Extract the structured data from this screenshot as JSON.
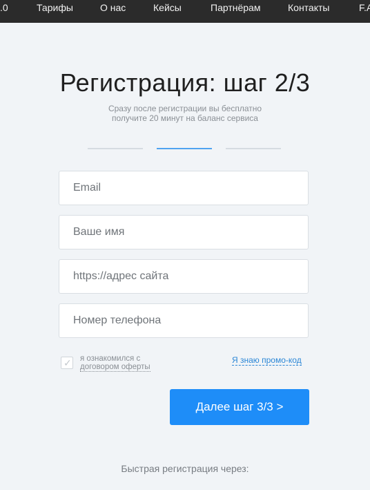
{
  "nav": {
    "items": [
      {
        "label": ".0"
      },
      {
        "label": "Тарифы"
      },
      {
        "label": "О нас"
      },
      {
        "label": "Кейсы"
      },
      {
        "label": "Партнёрам"
      },
      {
        "label": "Контакты"
      },
      {
        "label": "F.A"
      }
    ]
  },
  "registration": {
    "title": "Регистрация: шаг 2/3",
    "subtitle_line1": "Сразу после регистрации вы бесплатно",
    "subtitle_line2": "получите 20 минут на баланс сервиса",
    "steps_total": 3,
    "current_step": 2
  },
  "form": {
    "email_placeholder": "Email",
    "name_placeholder": "Ваше имя",
    "site_placeholder": "https://адрес сайта",
    "phone_placeholder": "Номер телефона",
    "agree_line1": "я ознакомился с",
    "agree_link": "договором оферты",
    "promo_link": "Я знаю промо-код",
    "next_button": "Далее шаг 3/3 >"
  },
  "footer": {
    "fast_registration": "Быстрая регистрация через:"
  }
}
